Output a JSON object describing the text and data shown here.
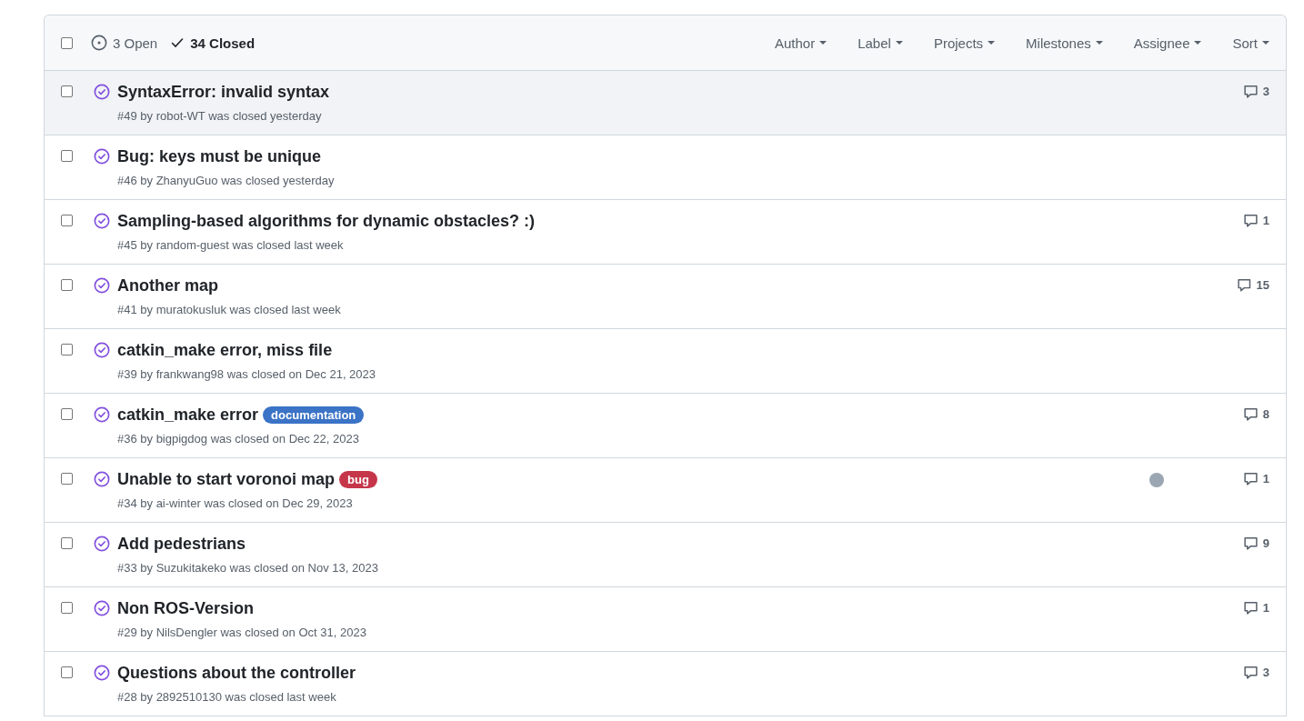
{
  "select_all": {
    "checked": false
  },
  "states": [
    {
      "label": "3 Open",
      "kind": "open",
      "selected": false
    },
    {
      "label": "34 Closed",
      "kind": "closed",
      "selected": true
    }
  ],
  "filters": [
    "Author",
    "Label",
    "Projects",
    "Milestones",
    "Assignee",
    "Sort"
  ],
  "issues": [
    {
      "title": "SyntaxError: invalid syntax",
      "meta": "#49 by robot-WT was closed yesterday",
      "comments": "3",
      "highlighted": true
    },
    {
      "title": "Bug: keys must be unique",
      "meta": "#46 by ZhanyuGuo was closed yesterday",
      "highlighted": false
    },
    {
      "title": "Sampling-based algorithms for dynamic obstacles? :)",
      "meta": "#45 by random-guest was closed last week",
      "comments": "1",
      "highlighted": false
    },
    {
      "title": "Another map",
      "meta": "#41 by muratokusluk was closed last week",
      "comments": "15",
      "highlighted": false
    },
    {
      "title": "catkin_make error, miss file",
      "meta": "#39 by frankwang98 was closed on Dec 21, 2023",
      "highlighted": false
    },
    {
      "title": "catkin_make error",
      "labels": [
        {
          "name": "documentation",
          "color": "#3b73c6"
        }
      ],
      "meta": "#36 by bigpigdog was closed on Dec 22, 2023",
      "comments": "8",
      "highlighted": false
    },
    {
      "title": "Unable to start voronoi map",
      "labels": [
        {
          "name": "bug",
          "color": "#c5364a"
        }
      ],
      "meta": "#34 by ai-winter was closed on Dec 29, 2023",
      "assignee": true,
      "comments": "1",
      "highlighted": false
    },
    {
      "title": "Add pedestrians",
      "meta": "#33 by Suzukitakeko was closed on Nov 13, 2023",
      "comments": "9",
      "highlighted": false
    },
    {
      "title": "Non ROS-Version",
      "meta": "#29 by NilsDengler was closed on Oct 31, 2023",
      "comments": "1",
      "highlighted": false
    },
    {
      "title": "Questions about the controller",
      "meta": "#28 by 2892510130 was closed last week",
      "comments": "3",
      "highlighted": false
    }
  ]
}
